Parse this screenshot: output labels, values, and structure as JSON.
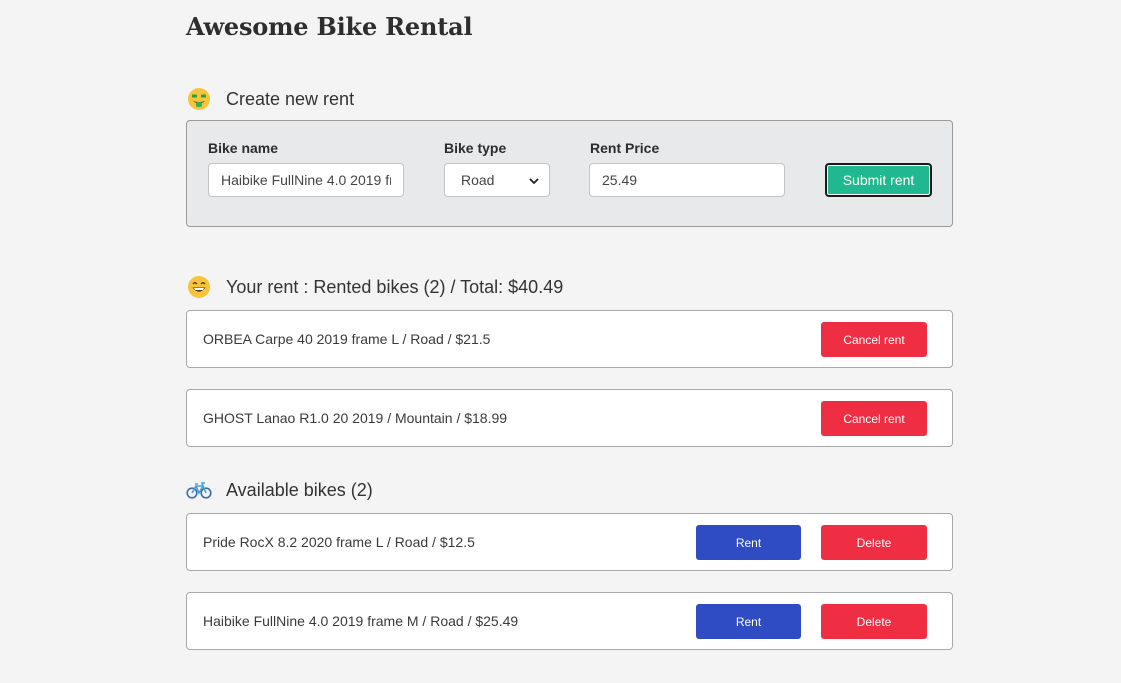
{
  "page": {
    "title": "Awesome Bike Rental"
  },
  "create_section": {
    "emoji": "money-mouth-face-icon",
    "title": "Create new rent",
    "bike_name_label": "Bike name",
    "bike_name_value": "Haibike FullNine 4.0 2019 fr",
    "bike_type_label": "Bike type",
    "bike_type_value": "Road",
    "rent_price_label": "Rent Price",
    "rent_price_value": "25.49",
    "submit_label": "Submit rent"
  },
  "rent_section": {
    "emoji": "grinning-face-icon",
    "title": "Your rent : Rented bikes (2) / Total: $40.49",
    "items": [
      {
        "text": "ORBEA Carpe 40 2019 frame L / Road / $21.5",
        "cancel_label": "Cancel rent"
      },
      {
        "text": "GHOST Lanao R1.0 20 2019 / Mountain / $18.99",
        "cancel_label": "Cancel rent"
      }
    ]
  },
  "available_section": {
    "emoji": "bicycle-icon",
    "title": "Available bikes (2)",
    "items": [
      {
        "text": "Pride RocX 8.2 2020 frame L / Road / $12.5",
        "rent_label": "Rent",
        "delete_label": "Delete"
      },
      {
        "text": "Haibike FullNine 4.0 2019 frame M / Road / $25.49",
        "rent_label": "Rent",
        "delete_label": "Delete"
      }
    ]
  },
  "colors": {
    "background": "#f4f4f4",
    "submit": "#20b88e",
    "danger": "#ef2e43",
    "primary": "#2f4cc4"
  }
}
